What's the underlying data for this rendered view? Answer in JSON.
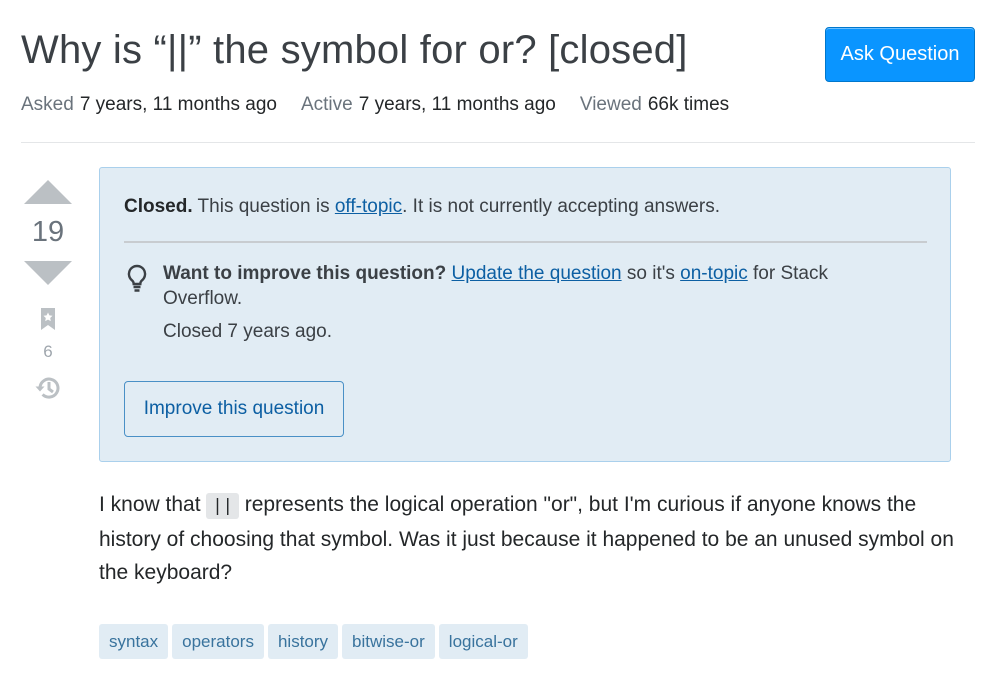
{
  "question": {
    "title": "Why is “||” the symbol for or? [closed]",
    "ask_button": "Ask Question",
    "meta": {
      "asked_label": "Asked",
      "asked_value": "7 years, 11 months ago",
      "active_label": "Active",
      "active_value": "7 years, 11 months ago",
      "viewed_label": "Viewed",
      "viewed_value": "66k times"
    },
    "votes": {
      "count": "19",
      "bookmarks": "6"
    },
    "notice": {
      "closed_bold": "Closed.",
      "closed_pre": " This question is ",
      "closed_link": "off-topic",
      "closed_post": ". It is not currently accepting answers.",
      "improve_bold": "Want to improve this question?",
      "improve_link": "Update the question",
      "improve_mid": " so it's ",
      "improve_link2": "on-topic",
      "improve_post": " for Stack Overflow.",
      "closed_ago": "Closed 7 years ago.",
      "improve_button": "Improve this question"
    },
    "body": {
      "pre": "I know that ",
      "code": "||",
      "post": " represents the logical operation \"or\", but I'm curious if anyone knows the history of choosing that symbol. Was it just because it happened to be an unused symbol on the keyboard?"
    },
    "tags": [
      "syntax",
      "operators",
      "history",
      "bitwise-or",
      "logical-or"
    ]
  },
  "colors": {
    "accent": "#0a95ff",
    "notice_bg": "#e1ecf4",
    "tag_bg": "#e1ecf4",
    "tag_text": "#39739d",
    "link": "#0c5fa3"
  },
  "icons": [
    "arrow-up-icon",
    "arrow-down-icon",
    "bookmark-icon",
    "history-icon",
    "lightbulb-icon"
  ]
}
